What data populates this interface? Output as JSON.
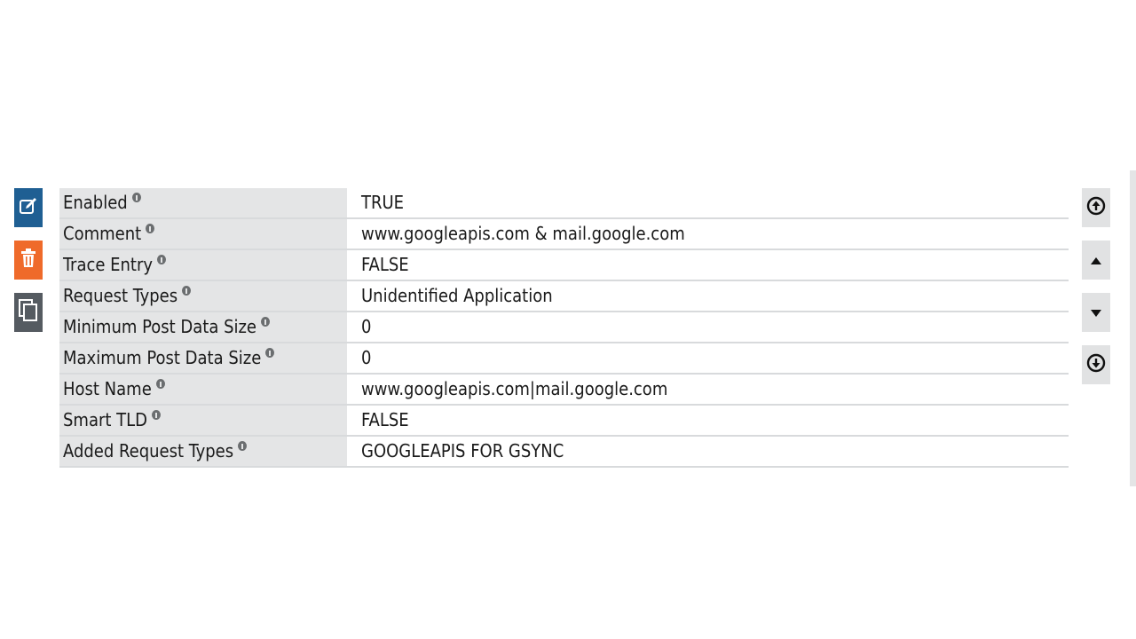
{
  "actions": [
    {
      "name": "edit-button",
      "icon": "edit-icon"
    },
    {
      "name": "delete-button",
      "icon": "trash-icon"
    },
    {
      "name": "copy-button",
      "icon": "copy-icon"
    }
  ],
  "properties": [
    {
      "label": "Enabled",
      "value": "TRUE"
    },
    {
      "label": "Comment",
      "value": "www.googleapis.com & mail.google.com"
    },
    {
      "label": "Trace Entry",
      "value": "FALSE"
    },
    {
      "label": "Request Types",
      "value": "Unidentified Application"
    },
    {
      "label": "Minimum Post Data Size",
      "value": "0"
    },
    {
      "label": "Maximum Post Data Size",
      "value": "0"
    },
    {
      "label": "Host Name",
      "value": "www.googleapis.com|mail.google.com"
    },
    {
      "label": "Smart TLD",
      "value": "FALSE"
    },
    {
      "label": "Added Request Types",
      "value": "GOOGLEAPIS FOR GSYNC"
    }
  ],
  "navigation": [
    "move-top-icon",
    "move-up-icon",
    "move-down-icon",
    "move-bottom-icon"
  ],
  "colors": {
    "edit": "#1f5f93",
    "delete": "#ef6a2a",
    "copy": "#555b61",
    "label_bg": "#e4e5e6"
  }
}
